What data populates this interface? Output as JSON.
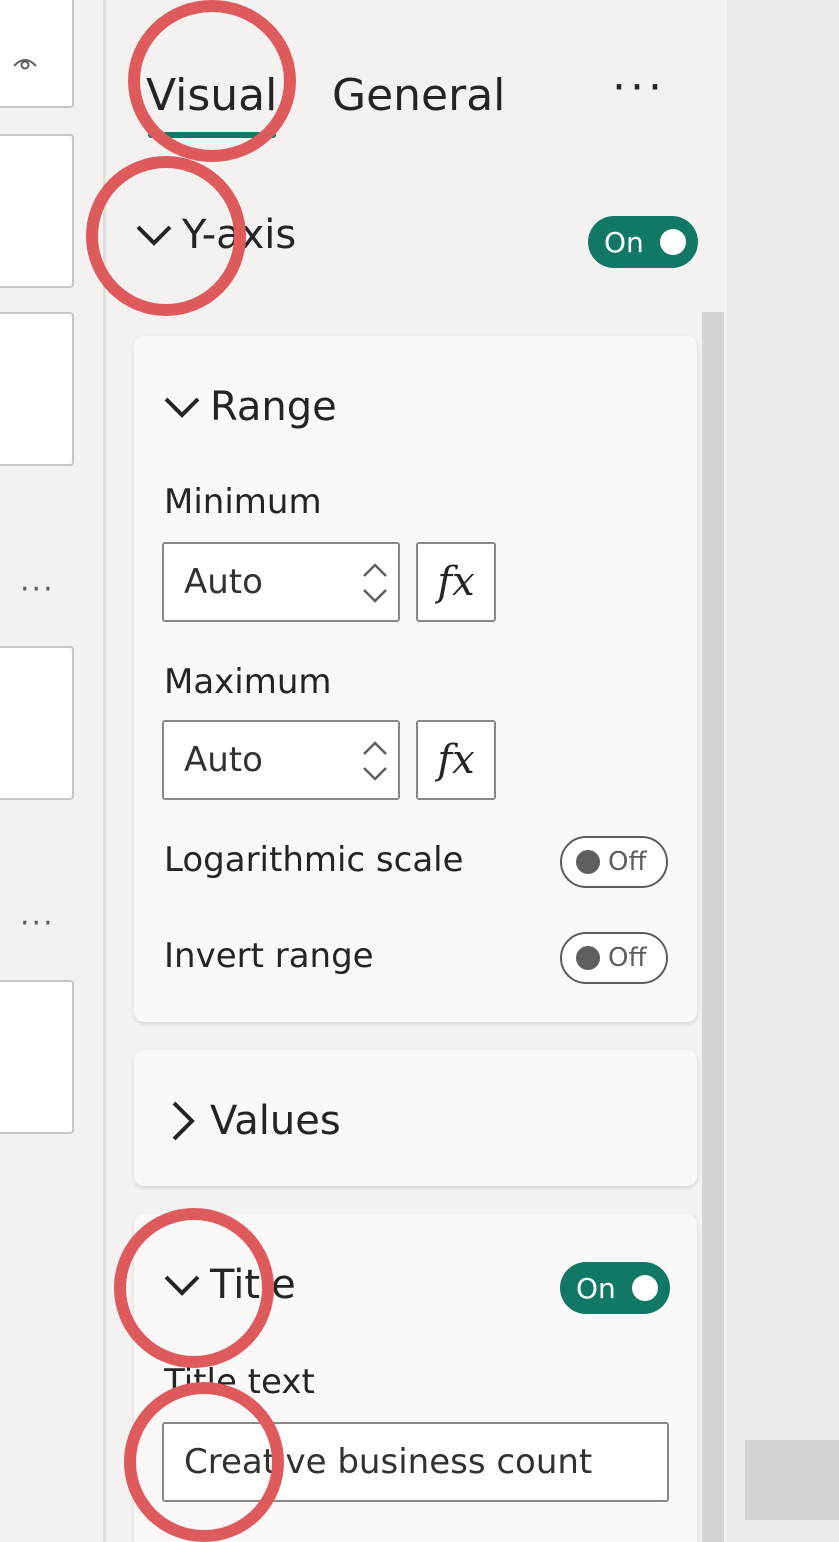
{
  "tabs": {
    "visual": "Visual",
    "general": "General",
    "more": "···"
  },
  "yaxis": {
    "label": "Y-axis",
    "toggle": "On"
  },
  "range": {
    "label": "Range",
    "minimum_label": "Minimum",
    "minimum_value": "Auto",
    "maximum_label": "Maximum",
    "maximum_value": "Auto",
    "fx_label": "fx",
    "log_label": "Logarithmic scale",
    "log_toggle": "Off",
    "invert_label": "Invert range",
    "invert_toggle": "Off"
  },
  "values": {
    "label": "Values"
  },
  "title": {
    "label": "Title",
    "toggle": "On",
    "text_label": "Title text",
    "text_value": "Creative business count"
  },
  "left_panel": {
    "dots": "···"
  },
  "colors": {
    "accent": "#117865",
    "annotation": "#de5a5d"
  }
}
